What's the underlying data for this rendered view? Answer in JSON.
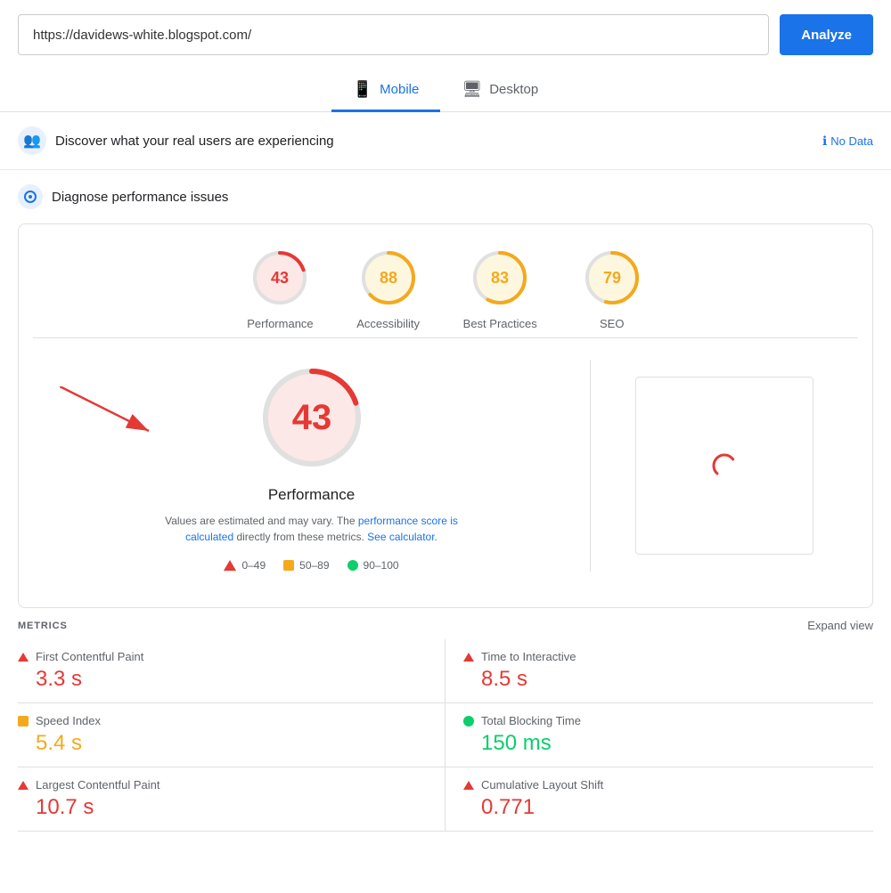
{
  "topbar": {
    "url_value": "https://davidews-white.blogspot.com/",
    "analyze_label": "Analyze"
  },
  "tabs": [
    {
      "id": "mobile",
      "label": "Mobile",
      "active": true,
      "icon": "📱"
    },
    {
      "id": "desktop",
      "label": "Desktop",
      "active": false,
      "icon": "🖥"
    }
  ],
  "real_users_banner": {
    "title": "Discover what your real users are experiencing",
    "no_data_label": "No Data"
  },
  "diagnose_section": {
    "title": "Diagnose performance issues"
  },
  "scores": [
    {
      "id": "performance",
      "label": "Performance",
      "value": 43,
      "color": "#e53935",
      "bg": "#fce8e6",
      "stroke": "#e53935",
      "dash": "45 100"
    },
    {
      "id": "accessibility",
      "label": "Accessibility",
      "value": 88,
      "color": "#f4a91d",
      "bg": "#fef7e0",
      "stroke": "#f4a91d",
      "dash": "88 100"
    },
    {
      "id": "best-practices",
      "label": "Best Practices",
      "value": 83,
      "color": "#f4a91d",
      "bg": "#fef7e0",
      "stroke": "#f4a91d",
      "dash": "83 100"
    },
    {
      "id": "seo",
      "label": "SEO",
      "value": 79,
      "color": "#f4a91d",
      "bg": "#fef7e0",
      "stroke": "#f4a91d",
      "dash": "79 100"
    }
  ],
  "big_score": {
    "value": "43",
    "label": "Performance",
    "desc_text": "Values are estimated and may vary. The ",
    "link1_text": "performance score is calculated",
    "desc_mid": " directly from these metrics. ",
    "link2_text": "See calculator",
    "desc_end": "."
  },
  "legend": [
    {
      "type": "triangle",
      "range": "0–49"
    },
    {
      "type": "square",
      "range": "50–89"
    },
    {
      "type": "circle",
      "range": "90–100"
    }
  ],
  "metrics": {
    "section_title": "METRICS",
    "expand_label": "Expand view",
    "items": [
      {
        "name": "First Contentful Paint",
        "value": "3.3 s",
        "indicator": "red",
        "side": "left"
      },
      {
        "name": "Time to Interactive",
        "value": "8.5 s",
        "indicator": "red",
        "side": "right"
      },
      {
        "name": "Speed Index",
        "value": "5.4 s",
        "indicator": "orange",
        "side": "left"
      },
      {
        "name": "Total Blocking Time",
        "value": "150 ms",
        "indicator": "green",
        "side": "right"
      },
      {
        "name": "Largest Contentful Paint",
        "value": "10.7 s",
        "indicator": "red",
        "side": "left"
      },
      {
        "name": "Cumulative Layout Shift",
        "value": "0.771",
        "indicator": "red",
        "side": "right"
      }
    ]
  }
}
